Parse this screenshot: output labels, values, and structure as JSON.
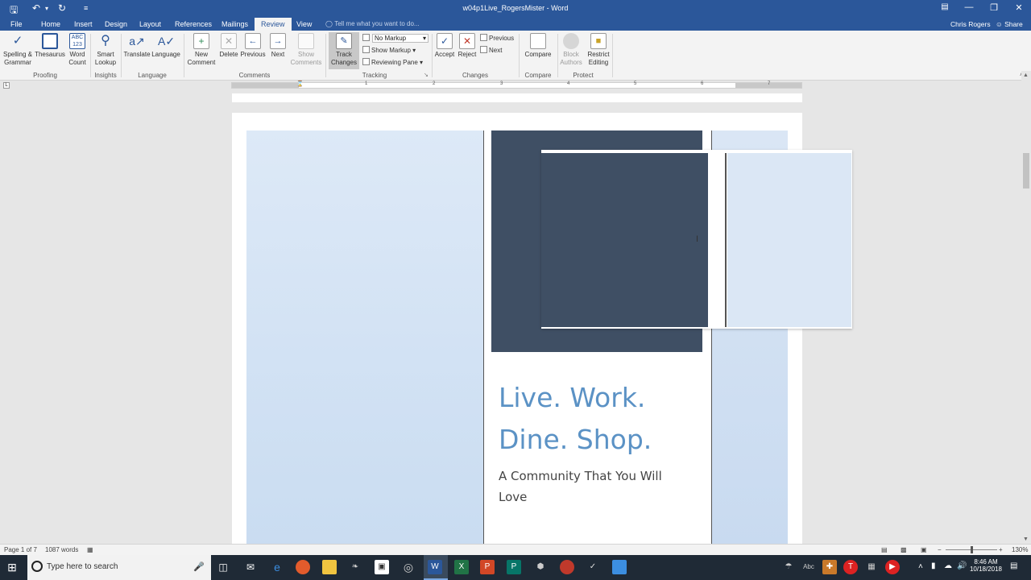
{
  "titlebar": {
    "title": "w04p1Live_RogersMister - Word",
    "save_icon": "save-icon",
    "undo_icon": "undo-icon",
    "redo_icon": "redo-icon",
    "customize_icon": "customize-qat-icon"
  },
  "tabs": [
    "File",
    "Home",
    "Insert",
    "Design",
    "Layout",
    "References",
    "Mailings",
    "Review",
    "View"
  ],
  "active_tab": "Review",
  "tellme_placeholder": "Tell me what you want to do...",
  "user_name": "Chris Rogers",
  "share_label": "Share",
  "ribbon": {
    "spelling": "Spelling &",
    "spelling2": "Grammar",
    "thesaurus": "Thesaurus",
    "wordcount": "Word",
    "wordcount2": "Count",
    "smartlookup": "Smart",
    "smartlookup2": "Lookup",
    "translate": "Translate",
    "language": "Language",
    "newcomment": "New",
    "newcomment2": "Comment",
    "delete": "Delete",
    "previous": "Previous",
    "next": "Next",
    "showcomments": "Show",
    "showcomments2": "Comments",
    "trackchanges": "Track",
    "trackchanges2": "Changes",
    "markup_select": "No Markup",
    "showmarkup": "Show Markup",
    "reviewingpane": "Reviewing Pane",
    "accept": "Accept",
    "reject": "Reject",
    "change_previous": "Previous",
    "change_next": "Next",
    "compare": "Compare",
    "blockauthors": "Block",
    "blockauthors2": "Authors",
    "restrict": "Restrict",
    "restrict2": "Editing",
    "groups": {
      "proofing": "Proofing",
      "insights": "Insights",
      "language": "Language",
      "comments": "Comments",
      "tracking": "Tracking",
      "changes": "Changes",
      "compare": "Compare",
      "protect": "Protect"
    }
  },
  "ruler_numbers": [
    "1",
    "2",
    "3",
    "4",
    "5",
    "6",
    "7"
  ],
  "document": {
    "headline_line1": "Live. Work.",
    "headline_line2": "Dine. Shop.",
    "subhead_line1": "A Community That You Will",
    "subhead_line2": "Love",
    "colors": {
      "dark_panel": "#3f4f64",
      "light_panel": "#dbe7f5",
      "headline": "#5b92c5",
      "subhead": "#444444"
    }
  },
  "statusbar": {
    "page": "Page 1 of 7",
    "words": "1087 words",
    "zoom": "130%"
  },
  "taskbar": {
    "search_placeholder": "Type here to search",
    "time": "8:46 AM",
    "date": "10/18/2018"
  }
}
